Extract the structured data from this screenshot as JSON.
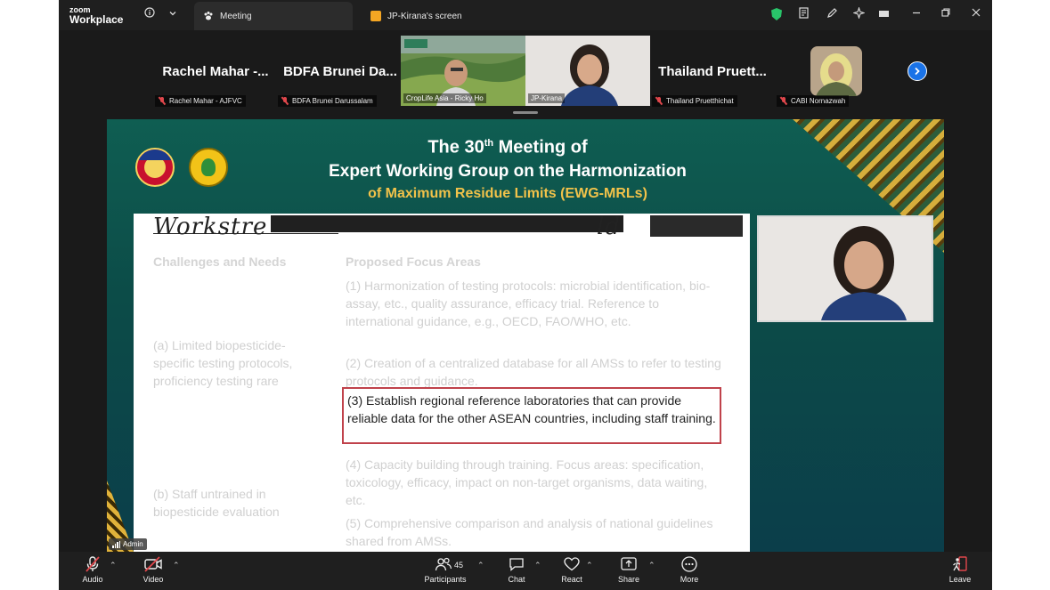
{
  "app": {
    "brand_small": "zoom",
    "brand_large": "Workplace"
  },
  "tabs": [
    {
      "label": "Meeting"
    },
    {
      "label": "JP-Kirana's screen"
    }
  ],
  "gallery": {
    "tiles": [
      {
        "name": "Rachel  Mahar  -...",
        "label": "Rachel Mahar - AJFVC"
      },
      {
        "name": "BDFA  Brunei  Da...",
        "label": "BDFA Brunei Darussalam"
      },
      {
        "name": "Thailand  Pruett...",
        "label": "Thailand Pruetthichat"
      }
    ],
    "videos": [
      {
        "label": "CropLife Asia - Ricky Ho"
      },
      {
        "label": "JP-Kirana"
      }
    ],
    "cabi_label": "CABI Nornazwah"
  },
  "slide": {
    "title_prefix": "The 30",
    "title_sup": "th",
    "title_suffix": " Meeting of",
    "title_line2": "Expert Working Group on the Harmonization",
    "title_line3": "of Maximum Residue Limits (EWG-MRLs)",
    "workstream": "Workstre",
    "workstream_tail": "ld",
    "col_challenges": "Challenges and Needs",
    "col_focus": "Proposed Focus Areas",
    "challenges": [
      "(a) Limited biopesticide-specific testing protocols, proficiency testing rare",
      "(b) Staff untrained in biopesticide evaluation"
    ],
    "focus": [
      "(1) Harmonization of testing protocols: microbial identification, bio-assay, etc., quality assurance, efficacy trial. Reference to international guidance, e.g., OECD, FAO/WHO, etc.",
      "(2) Creation of a centralized database for all AMSs to refer to testing protocols and guidance.",
      "(4) Capacity building through training. Focus areas: specification, toxicology, efficacy, impact on non-target organisms, data waiting, etc.",
      "(5) Comprehensive comparison and analysis of national guidelines shared from AMSs."
    ],
    "highlight": "(3) Establish regional reference laboratories that can provide reliable data for the other ASEAN countries, including staff training."
  },
  "admin_tag": "Admin",
  "toolbar": {
    "audio": "Audio",
    "video": "Video",
    "participants": "Participants",
    "participants_count": "45",
    "chat": "Chat",
    "react": "React",
    "share": "Share",
    "more": "More",
    "leave": "Leave"
  }
}
